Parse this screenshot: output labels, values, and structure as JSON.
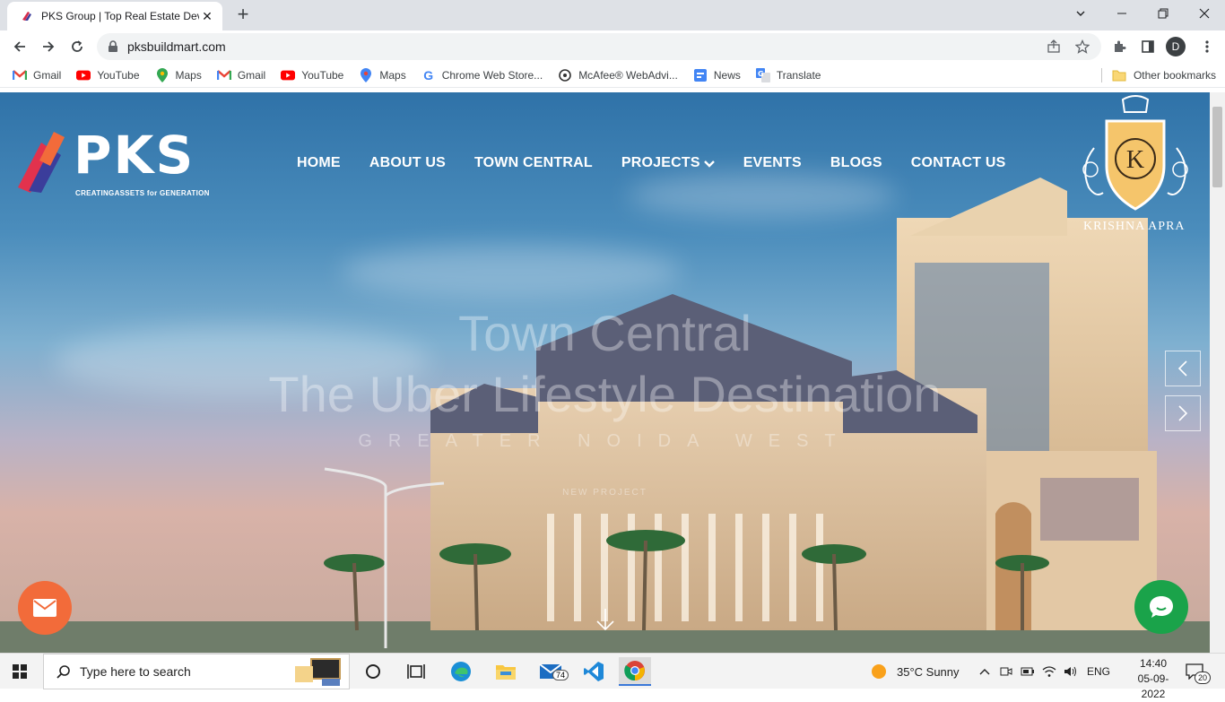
{
  "browser": {
    "tab_title": "PKS Group | Top Real Estate Deve",
    "url": "pksbuildmart.com",
    "profile_initial": "D"
  },
  "bookmarks": [
    {
      "label": "Gmail",
      "icon": "gmail-icon"
    },
    {
      "label": "YouTube",
      "icon": "youtube-icon"
    },
    {
      "label": "Maps",
      "icon": "maps-icon"
    },
    {
      "label": "Gmail",
      "icon": "gmail-icon"
    },
    {
      "label": "YouTube",
      "icon": "youtube-icon"
    },
    {
      "label": "Maps",
      "icon": "maps-icon"
    },
    {
      "label": "Chrome Web Store...",
      "icon": "google-icon"
    },
    {
      "label": "McAfee® WebAdvi...",
      "icon": "mcafee-icon"
    },
    {
      "label": "News",
      "icon": "news-icon"
    },
    {
      "label": "Translate",
      "icon": "translate-icon"
    }
  ],
  "other_bookmarks": "Other bookmarks",
  "site": {
    "logo_text": "PKS",
    "logo_tagline": "CREATINGASSETS for GENERATION",
    "nav": [
      "HOME",
      "ABOUT US",
      "TOWN CENTRAL",
      "PROJECTS",
      "EVENTS",
      "BLOGS",
      "CONTACT US"
    ],
    "crest_letter": "K",
    "crest_name": "KRISHNA APRA",
    "hero_line1": "Town Central",
    "hero_line2": "The Uber Lifestyle Destination",
    "hero_line3": "GREATER NOIDA WEST",
    "hero_small": "NEW PROJECT"
  },
  "taskbar": {
    "search_placeholder": "Type here to search",
    "mail_badge": "74",
    "weather": "35°C  Sunny",
    "language": "ENG",
    "time": "14:40",
    "date": "05-09-2022",
    "notifications": "20"
  },
  "colors": {
    "brand_orange": "#f26b3a",
    "chat_green": "#1aa34a",
    "crest_gold": "#f5c56b"
  }
}
